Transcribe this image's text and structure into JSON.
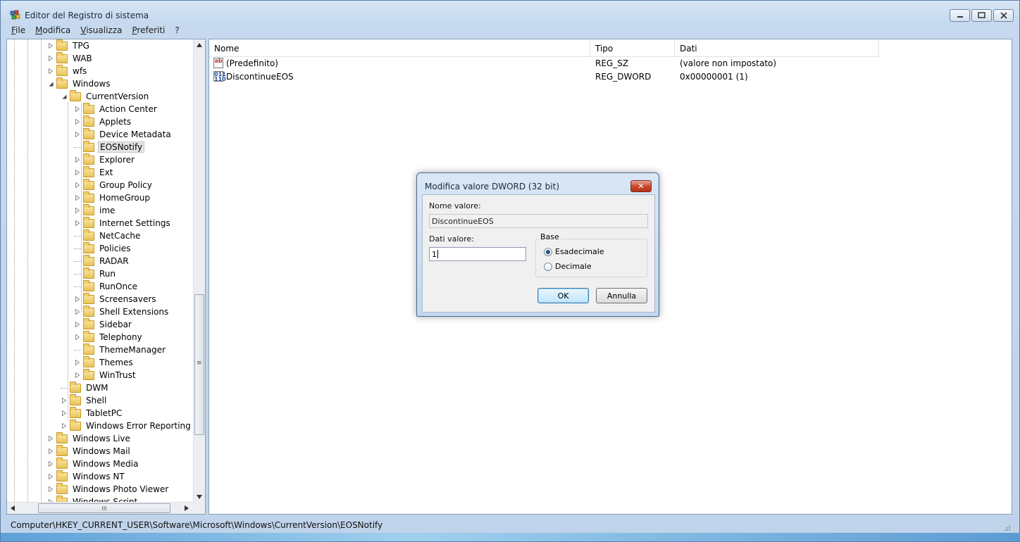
{
  "window": {
    "title": "Editor del Registro di sistema"
  },
  "menu": [
    "File",
    "Modifica",
    "Visualizza",
    "Preferiti",
    "?"
  ],
  "tree": [
    {
      "label": "TPG",
      "expander": "collapsed",
      "selected": false
    },
    {
      "label": "WAB",
      "expander": "collapsed",
      "selected": false
    },
    {
      "label": "wfs",
      "expander": "collapsed",
      "selected": false
    },
    {
      "label": "Windows",
      "expander": "expanded",
      "selected": false
    },
    {
      "label": "CurrentVersion",
      "expander": "expanded",
      "selected": false
    },
    {
      "label": "Action Center",
      "expander": "collapsed",
      "selected": false
    },
    {
      "label": "Applets",
      "expander": "collapsed",
      "selected": false
    },
    {
      "label": "Device Metadata",
      "expander": "collapsed",
      "selected": false
    },
    {
      "label": "EOSNotify",
      "expander": "none",
      "selected": true
    },
    {
      "label": "Explorer",
      "expander": "collapsed",
      "selected": false
    },
    {
      "label": "Ext",
      "expander": "collapsed",
      "selected": false
    },
    {
      "label": "Group Policy",
      "expander": "collapsed",
      "selected": false
    },
    {
      "label": "HomeGroup",
      "expander": "collapsed",
      "selected": false
    },
    {
      "label": "ime",
      "expander": "collapsed",
      "selected": false
    },
    {
      "label": "Internet Settings",
      "expander": "collapsed",
      "selected": false
    },
    {
      "label": "NetCache",
      "expander": "none",
      "selected": false
    },
    {
      "label": "Policies",
      "expander": "none",
      "selected": false
    },
    {
      "label": "RADAR",
      "expander": "none",
      "selected": false
    },
    {
      "label": "Run",
      "expander": "none",
      "selected": false
    },
    {
      "label": "RunOnce",
      "expander": "none",
      "selected": false
    },
    {
      "label": "Screensavers",
      "expander": "collapsed",
      "selected": false
    },
    {
      "label": "Shell Extensions",
      "expander": "collapsed",
      "selected": false
    },
    {
      "label": "Sidebar",
      "expander": "collapsed",
      "selected": false
    },
    {
      "label": "Telephony",
      "expander": "collapsed",
      "selected": false
    },
    {
      "label": "ThemeManager",
      "expander": "none",
      "selected": false
    },
    {
      "label": "Themes",
      "expander": "collapsed",
      "selected": false
    },
    {
      "label": "WinTrust",
      "expander": "collapsed",
      "selected": false
    },
    {
      "label": "DWM",
      "expander": "none",
      "selected": false
    },
    {
      "label": "Shell",
      "expander": "collapsed",
      "selected": false
    },
    {
      "label": "TabletPC",
      "expander": "collapsed",
      "selected": false
    },
    {
      "label": "Windows Error Reporting",
      "expander": "collapsed",
      "selected": false
    },
    {
      "label": "Windows Live",
      "expander": "collapsed",
      "selected": false
    },
    {
      "label": "Windows Mail",
      "expander": "collapsed",
      "selected": false
    },
    {
      "label": "Windows Media",
      "expander": "collapsed",
      "selected": false
    },
    {
      "label": "Windows NT",
      "expander": "collapsed",
      "selected": false
    },
    {
      "label": "Windows Photo Viewer",
      "expander": "collapsed",
      "selected": false
    },
    {
      "label": "Windows Script",
      "expander": "collapsed",
      "selected": false
    }
  ],
  "list": {
    "columns": [
      "Nome",
      "Tipo",
      "Dati"
    ],
    "rows": [
      {
        "icon": "string-value-icon",
        "icon_text": "ab",
        "name": "(Predefinito)",
        "type": "REG_SZ",
        "data": "(valore non impostato)"
      },
      {
        "icon": "binary-value-icon",
        "icon_text": "011 110",
        "name": "DiscontinueEOS",
        "type": "REG_DWORD",
        "data": "0x00000001 (1)"
      }
    ]
  },
  "status": {
    "path": "Computer\\HKEY_CURRENT_USER\\Software\\Microsoft\\Windows\\CurrentVersion\\EOSNotify"
  },
  "dialog": {
    "title": "Modifica valore DWORD (32 bit)",
    "close_glyph": "✕",
    "name_label": "Nome valore:",
    "name_value": "DiscontinueEOS",
    "data_label": "Dati valore:",
    "data_value": "1",
    "base_title": "Base",
    "radio_hex": "Esadecimale",
    "radio_dec": "Decimale",
    "selected_base": "Esadecimale",
    "ok": "OK",
    "cancel": "Annulla"
  },
  "scrollbar": {
    "h_thumb_glyph": "III",
    "v_thumb_glyph": "≡"
  },
  "colors": {
    "accent": "#3c7fb1",
    "close_red": "#c8452b",
    "folder": "#e8c25a"
  }
}
